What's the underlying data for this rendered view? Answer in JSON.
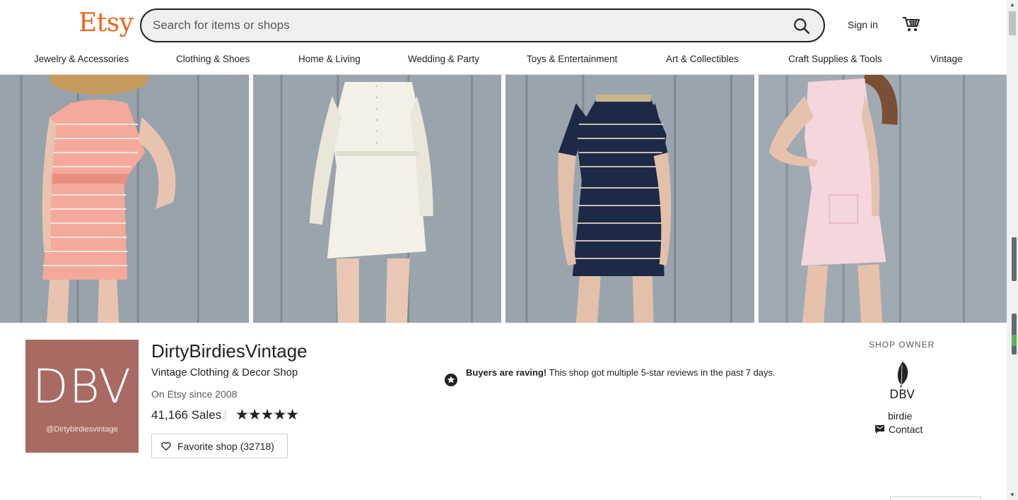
{
  "header": {
    "logo": "Etsy",
    "search_placeholder": "Search for items or shops",
    "signin_label": "Sign in",
    "brand_color": "#f1641e"
  },
  "nav": {
    "items": [
      "Jewelry & Accessories",
      "Clothing & Shoes",
      "Home & Living",
      "Wedding & Party",
      "Toys & Entertainment",
      "Art & Collectibles",
      "Craft Supplies & Tools",
      "Vintage"
    ]
  },
  "banner": {
    "images": [
      {
        "icon": "pink-striped-dress-photo",
        "dress_color": "#f4a99a"
      },
      {
        "icon": "white-shirt-dress-photo",
        "dress_color": "#f3f0e8"
      },
      {
        "icon": "navy-striped-dress-photo",
        "dress_color": "#1c2a48"
      },
      {
        "icon": "light-pink-dress-photo",
        "dress_color": "#f5d6dc"
      }
    ]
  },
  "shop": {
    "logo_text": "DBV",
    "logo_handle": "@Dirtybirdiesvintage",
    "logo_color": "#a86a62",
    "name": "DirtyBirdiesVintage",
    "tagline": "Vintage Clothing & Decor Shop",
    "since": "On Etsy since 2008",
    "sales": "41,166 Sales",
    "stars": "★★★★★",
    "rating_stars": 5,
    "favorite_label": "Favorite shop (32718)"
  },
  "raving": {
    "bold": "Buyers are raving!",
    "text": " This shop got multiple 5-star reviews in the past 7 days."
  },
  "owner": {
    "title": "SHOP OWNER",
    "avatar_text": "DBV",
    "name": "birdie",
    "contact_label": "Contact"
  }
}
